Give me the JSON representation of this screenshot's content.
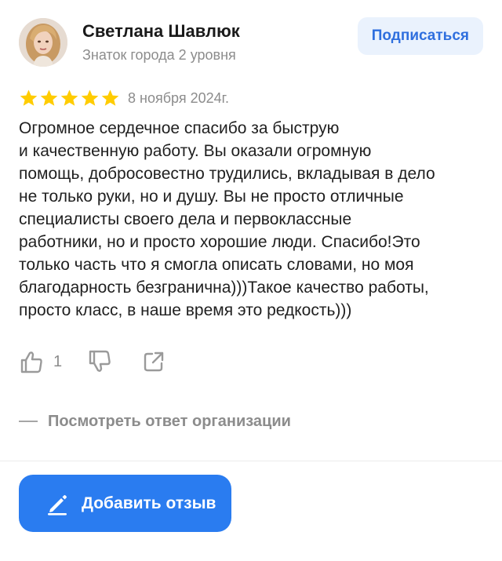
{
  "review": {
    "author": {
      "name": "Светлана Шавлюк",
      "level": "Знаток города 2 уровня"
    },
    "subscribe_label": "Подписаться",
    "rating": 5,
    "date": "8 ноября 2024г.",
    "text_lines": [
      "Огромное сердечное спасибо за быструю",
      "и качественную работу. Вы оказали огромную",
      "помощь, добросовестно трудились, вкладывая в дело",
      "не только руки, но и душу. Вы не просто отличные",
      "специалисты своего дела и первоклассные",
      "работники, но и просто хорошие люди. Спасибо!Это",
      "только часть что я смогла описать словами, но моя",
      "благодарность безгранична)))Такое качество работы,",
      "просто класс, в наше время это редкость)))"
    ],
    "likes": "1",
    "org_answer_label": "Посмотреть ответ организации"
  },
  "add_review_label": "Добавить отзыв",
  "colors": {
    "star": "#ffcc00",
    "accent": "#2a7cf0",
    "subscribe_bg": "#eaf2fd",
    "subscribe_text": "#2f6fde",
    "muted": "#8c8c8c"
  },
  "icons": {
    "rating": "star-icon",
    "like": "thumb-up-icon",
    "dislike": "thumb-down-icon",
    "share": "share-icon",
    "add": "pencil-icon"
  }
}
